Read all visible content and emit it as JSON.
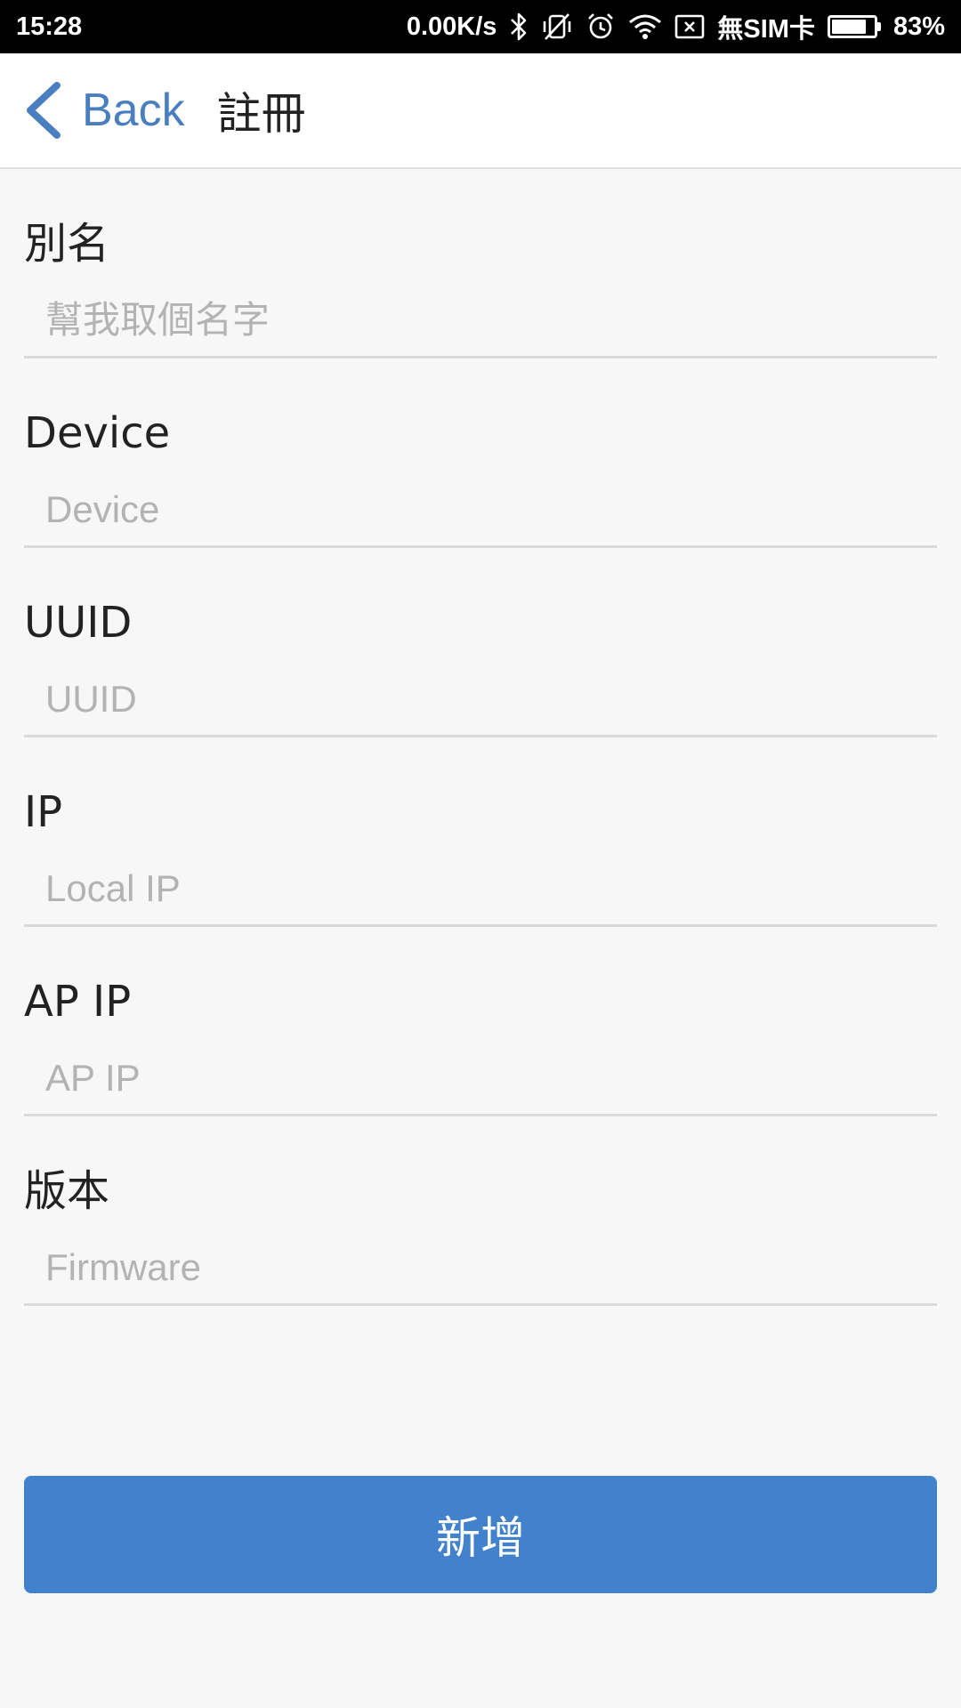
{
  "status_bar": {
    "time": "15:28",
    "network_speed": "0.00K/s",
    "carrier": "無SIM卡",
    "battery_percent": "83%",
    "battery_level": 0.83,
    "icons": [
      "bluetooth-icon",
      "vibrate-off-icon",
      "alarm-icon",
      "wifi-icon",
      "no-sim-icon",
      "battery-icon"
    ]
  },
  "nav": {
    "back_label": "Back",
    "title": "註冊",
    "accent_color": "#4a7fbf"
  },
  "form": {
    "fields": [
      {
        "label": "別名",
        "placeholder": "幫我取個名字",
        "value": ""
      },
      {
        "label": "Device",
        "placeholder": "Device",
        "value": ""
      },
      {
        "label": "UUID",
        "placeholder": "UUID",
        "value": ""
      },
      {
        "label": "IP",
        "placeholder": "Local IP",
        "value": ""
      },
      {
        "label": "AP IP",
        "placeholder": "AP IP",
        "value": ""
      },
      {
        "label": "版本",
        "placeholder": "Firmware",
        "value": ""
      }
    ]
  },
  "submit": {
    "label": "新增",
    "color": "#4281cc"
  }
}
